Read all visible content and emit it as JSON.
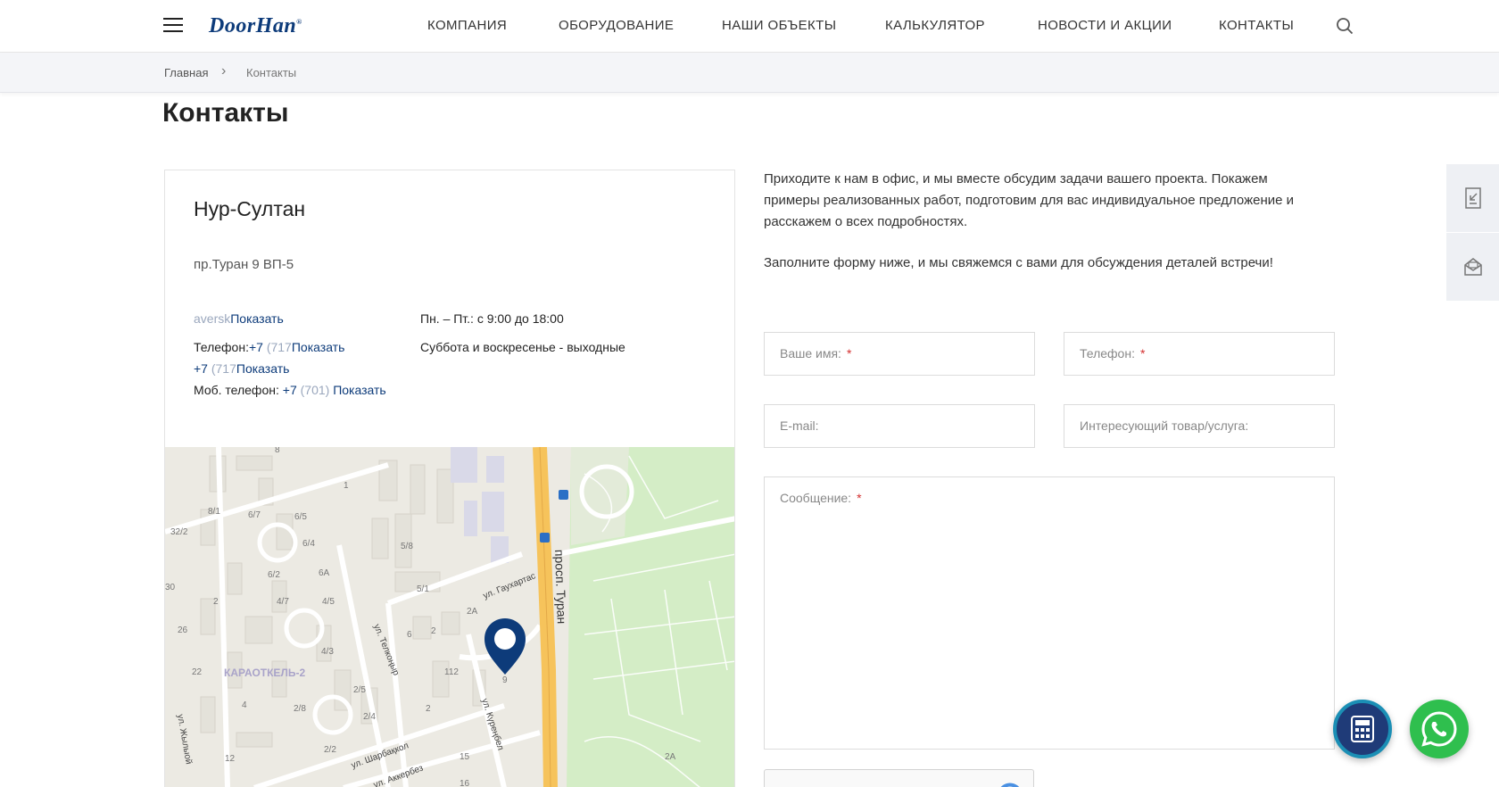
{
  "header": {
    "logo": "DoorHan",
    "logo_reg": "®",
    "nav": [
      "КОМПАНИЯ",
      "ОБОРУДОВАНИЕ",
      "НАШИ ОБЪЕКТЫ",
      "КАЛЬКУЛЯТОР",
      "НОВОСТИ И АКЦИИ",
      "КОНТАКТЫ"
    ]
  },
  "breadcrumb": {
    "home": "Главная",
    "separator": "›",
    "current": "Контакты"
  },
  "page_title": "Контакты",
  "office": {
    "city": "Нур-Султан",
    "address": "пр.Туран 9 ВП-5",
    "email_partial": "aversk",
    "show_label": "Показать",
    "phone_label": "Телефон:",
    "phone1_code": "+7",
    "phone1_partial": " (717",
    "phone2_code": "+7",
    "phone2_partial": " (717",
    "mobile_label": "Моб. телефон:",
    "mobile_code": "+7",
    "mobile_partial": " (701)",
    "hours_weekdays": "Пн. – Пт.: с 9:00 до 18:00",
    "hours_weekend": "Суббота и воскресенье - выходные"
  },
  "map": {
    "district": "КАРАОТКЕЛЬ-2",
    "streets": [
      "просп. Туран",
      "ул. Гаухартас",
      "ул. Телкоңыр",
      "ул. Күреңбел",
      "ул. Шарбақкол",
      "ул. Аккербез",
      "ул. Жылыой"
    ],
    "house_numbers": [
      "8",
      "1",
      "8/1",
      "6/7",
      "6/5",
      "32/2",
      "6/4",
      "5/8",
      "6A",
      "6/2",
      "5/1",
      "30",
      "2",
      "4/7",
      "4/5",
      "2A",
      "26",
      "6",
      "2",
      "4/3",
      "22",
      "112",
      "9",
      "2/5",
      "4",
      "2/8",
      "2/4",
      "2",
      "2/2",
      "12",
      "15",
      "16",
      "2A"
    ]
  },
  "contact_form": {
    "intro": "Приходите к нам в офис, и мы вместе обсудим задачи вашего проекта. Покажем примеры реализованных работ, подготовим для вас индивидуальное предложение и расскажем о всех подробностях.",
    "prompt": "Заполните форму ниже, и мы свяжемся с вами для обсуждения деталей встречи!",
    "name_placeholder": "Ваше имя:",
    "phone_placeholder": "Телефон:",
    "email_placeholder": "E-mail:",
    "product_placeholder": "Интересующий товар/услуга:",
    "message_placeholder": "Сообщение:",
    "required_mark": "*"
  },
  "icons": {
    "menu": "hamburger-icon",
    "search": "search-icon",
    "side_tab_1": "download-doc-icon",
    "side_tab_2": "mail-icon",
    "calculator": "calculator-icon",
    "whatsapp": "whatsapp-icon",
    "map_pin": "map-pin-icon"
  },
  "colors": {
    "brand": "#0d3b7a",
    "required": "#d32f2f",
    "whatsapp": "#2fbf4e",
    "road_major": "#f6c35b",
    "park": "#d4edc6"
  }
}
